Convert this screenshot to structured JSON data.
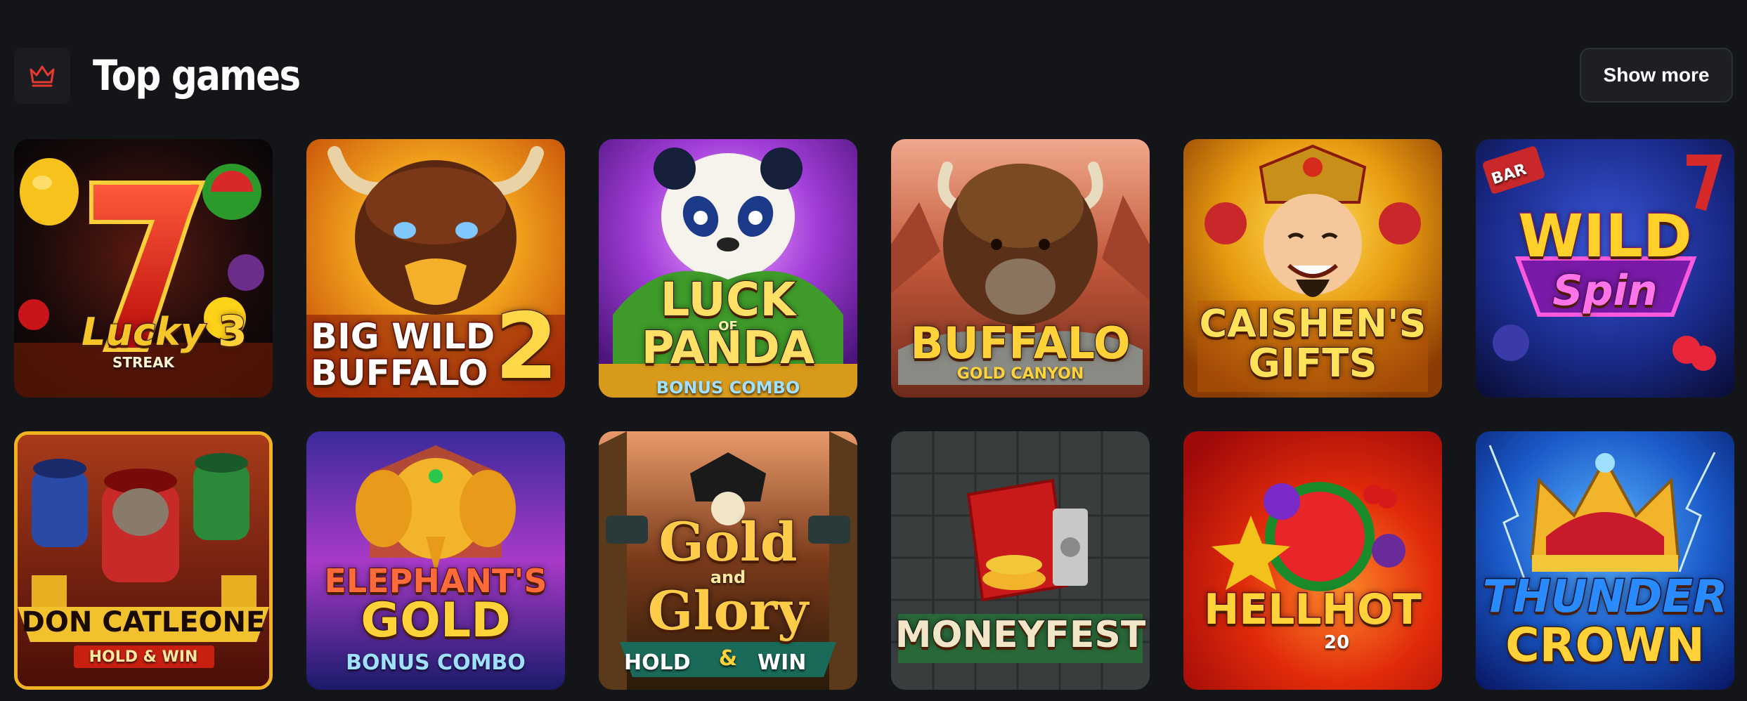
{
  "section": {
    "title": "Top games",
    "show_more_label": "Show more",
    "accent_color": "#e8392e"
  },
  "games": [
    {
      "line1": "Lucky",
      "line2": "3",
      "line3": "STREAK"
    },
    {
      "line1": "BIG WILD",
      "line2": "BUFFALO",
      "line3": "2"
    },
    {
      "line1": "LUCK",
      "line2": "OF",
      "line3": "PANDA",
      "line4": "BONUS COMBO"
    },
    {
      "line1": "BUFFALO",
      "line2": "GOLD CANYON"
    },
    {
      "line1": "CAISHEN'S",
      "line2": "GIFTS"
    },
    {
      "line1": "WILD",
      "line2": "Spin",
      "line3": "BAR"
    },
    {
      "line1": "DON CATLEONE",
      "line2": "HOLD & WIN"
    },
    {
      "line1": "ELEPHANT'S",
      "line2": "GOLD",
      "line3": "BONUS COMBO"
    },
    {
      "line1": "Gold",
      "line2": "and",
      "line3": "Glory",
      "line4": "HOLD",
      "line5": "&",
      "line6": "WIN"
    },
    {
      "line1": "MONEYFEST"
    },
    {
      "line1": "HELLHOT",
      "line2": "20"
    },
    {
      "line1": "THUNDER",
      "line2": "CROWN"
    }
  ]
}
